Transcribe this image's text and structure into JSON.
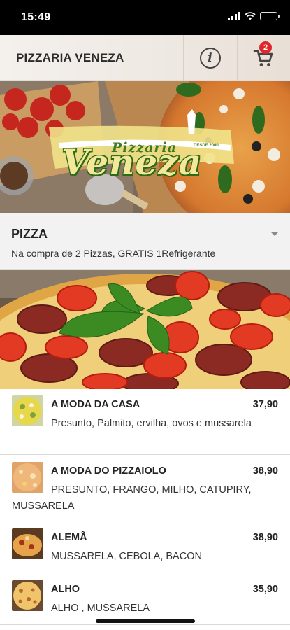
{
  "status_bar": {
    "time": "15:49"
  },
  "header": {
    "title": "PIZZARIA VENEZA",
    "info_icon": "info-icon",
    "cart_icon": "cart-icon",
    "cart_count": "2"
  },
  "banner": {
    "logo_top": "Pizzaria",
    "logo_main": "Veneza",
    "logo_tag": "DESDE 2000"
  },
  "category": {
    "title": "PIZZA",
    "promo": "Na compra de 2 Pizzas, GRATIS 1Refrigerante"
  },
  "products": [
    {
      "name": "A MODA DA CASA",
      "price": "37,90",
      "description": "Presunto, Palmito, ervilha, ovos e mussarela"
    },
    {
      "name": "A MODA DO PIZZAIOLO",
      "price": "38,90",
      "description": "PRESUNTO, FRANGO, MILHO, CATUPIRY, MUSSARELA"
    },
    {
      "name": "ALEMÃ",
      "price": "38,90",
      "description": "MUSSARELA, CEBOLA, BACON"
    },
    {
      "name": "ALHO",
      "price": "35,90",
      "description": "ALHO , MUSSARELA"
    }
  ],
  "colors": {
    "badge": "#e0262a",
    "logo_green": "#3f7a1e",
    "logo_yellow": "#f1e38a"
  }
}
